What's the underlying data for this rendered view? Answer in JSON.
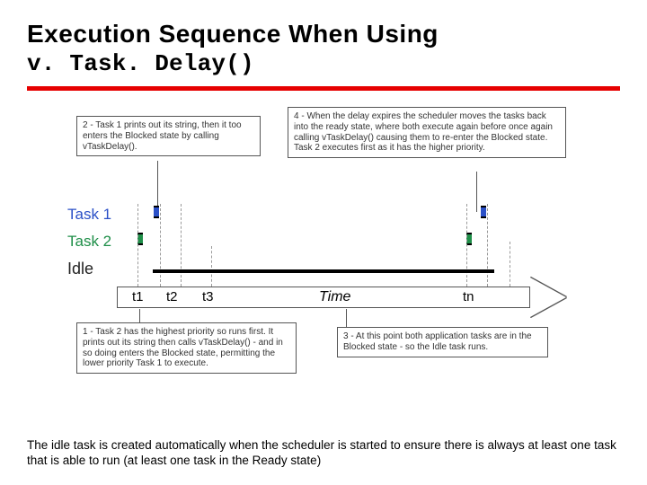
{
  "title": {
    "line1": "Execution Sequence When Using",
    "line2": "v. Task. Delay()"
  },
  "callouts": {
    "c1": "1 - Task 2 has the highest priority so runs first. It prints out its string then calls vTaskDelay() - and in so doing enters the Blocked state, permitting the lower priority Task 1 to execute.",
    "c2": "2 - Task 1 prints out its string, then it too enters the Blocked state by calling vTaskDelay().",
    "c3": "3 - At this point both application tasks are in the Blocked state - so the Idle task runs.",
    "c4": "4 - When the delay expires the scheduler moves the tasks back into the ready state, where both execute again before once again calling vTaskDelay() causing them to re-enter the Blocked state. Task 2 executes first as it has the higher priority."
  },
  "labels": {
    "task1": "Task 1",
    "task2": "Task 2",
    "idle": "Idle",
    "t1": "t1",
    "t2": "t2",
    "t3": "t3",
    "time": "Time",
    "tn": "tn"
  },
  "caption": "The idle task is created automatically when the scheduler is started to ensure there is always at least one task that is able to run (at least one task in the Ready state)"
}
